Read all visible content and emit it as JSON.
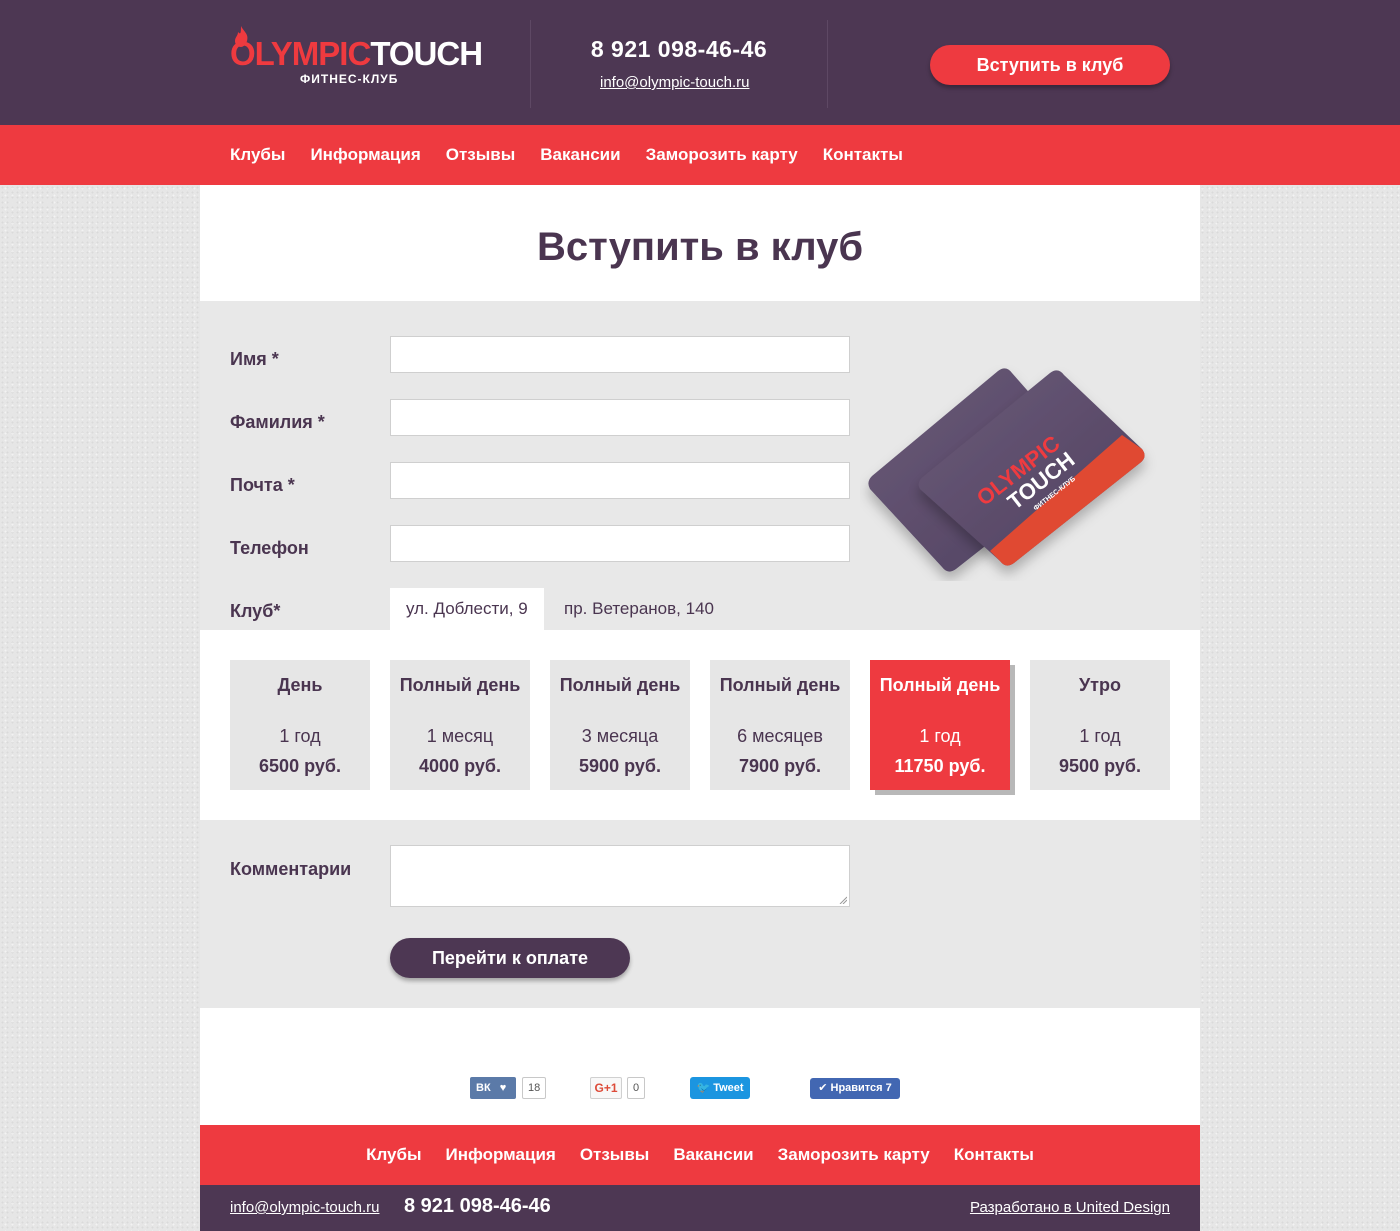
{
  "header": {
    "logo_olympic": "OLYMPIC",
    "logo_touch": "TOUCH",
    "logo_sub": "ФИТНЕС-КЛУБ",
    "phone": "8 921 098-46-46",
    "email": "info@olympic-touch.ru",
    "join_button": "Вступить в клуб"
  },
  "nav": {
    "items": [
      "Клубы",
      "Информация",
      "Отзывы",
      "Вакансии",
      "Заморозить карту",
      "Контакты"
    ]
  },
  "page": {
    "title": "Вступить в клуб"
  },
  "form": {
    "name_label": "Имя *",
    "surname_label": "Фамилия *",
    "email_label": "Почта *",
    "phone_label": "Телефон",
    "club_label": "Клуб*",
    "name_value": "",
    "surname_value": "",
    "email_value": "",
    "phone_value": "",
    "clubs": [
      "ул. Доблести, 9",
      "пр. Ветеранов, 140"
    ],
    "selected_club": "ул. Доблести, 9",
    "comment_label": "Комментарии",
    "comment_value": "",
    "pay_button": "Перейти к оплате"
  },
  "cards_image": {
    "brand_line1": "OLYMPIC",
    "brand_line2": "TOUCH",
    "brand_sub": "ФИТНЕС-КЛУБ"
  },
  "plans": [
    {
      "name": "День",
      "period": "1 год",
      "price": "6500 руб.",
      "selected": false
    },
    {
      "name": "Полный день",
      "period": "1 месяц",
      "price": "4000 руб.",
      "selected": false
    },
    {
      "name": "Полный день",
      "period": "3 месяца",
      "price": "5900 руб.",
      "selected": false
    },
    {
      "name": "Полный день",
      "period": "6 месяцев",
      "price": "7900 руб.",
      "selected": false
    },
    {
      "name": "Полный день",
      "period": "1 год",
      "price": "11750 руб.",
      "selected": true
    },
    {
      "name": "Утро",
      "period": "1 год",
      "price": "9500 руб.",
      "selected": false
    }
  ],
  "social": {
    "vk_label": "ВК",
    "vk_count": "18",
    "gplus_label": "G+1",
    "gplus_count": "0",
    "tweet_label": "Tweet",
    "fb_label": "Нравится 7"
  },
  "footer": {
    "email": "info@olympic-touch.ru",
    "phone": "8 921 098-46-46",
    "developer": "Разработано в United Design"
  },
  "colors": {
    "purple": "#4d3753",
    "red": "#ee3a40",
    "panel_gray": "#e8e8e8"
  }
}
